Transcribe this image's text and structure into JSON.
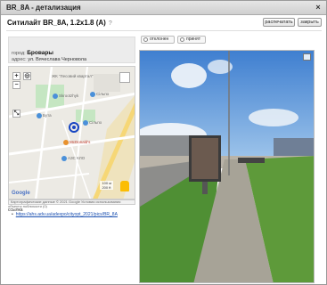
{
  "window": {
    "title": "BR_8A - детализация",
    "close_glyph": "×"
  },
  "header": {
    "title": "Ситилайт  BR_8A,  1.2x1.8  (A)",
    "help_glyph": "?",
    "print_label": "распечатать",
    "close_label": "закрыть"
  },
  "status": {
    "options": [
      {
        "label": "отклонен",
        "checked": false
      },
      {
        "label": "принят",
        "checked": false
      }
    ]
  },
  "info": {
    "city_label": "город:",
    "city_value": "Бровары",
    "address_label": "адрес:",
    "address_value": "ул. Вячеслава Черновола"
  },
  "map": {
    "labels": {
      "complex": "ЖК \"Лесовий квартал\"",
      "skrootzhyk": "Skrootzhyk",
      "silpo1": "Сільпо",
      "buta": "Бута",
      "silpo2": "Сільпо",
      "mcdonalds": "McDonald's",
      "azs": "АЗС КЛО",
      "google": "Google"
    },
    "scale": [
      "100 м",
      "200 ft"
    ],
    "footer": "Картографические данные © 2021 Google   Условия использования",
    "footer2": "Сообщить об ошибке на карте",
    "objects_label": "объекты поблизости (0)",
    "colors": {
      "park": "#c5e6c2",
      "road": "#ffffff",
      "major_road": "#f6d776",
      "pin": "#1746c2",
      "water": "#a9cdf2"
    }
  },
  "links": {
    "label": "ссылка",
    "items": [
      "https://ahs.adv.ua/adexpo/cityopt_2021/pics/BR_8A"
    ]
  },
  "photo": {
    "caption": ""
  }
}
